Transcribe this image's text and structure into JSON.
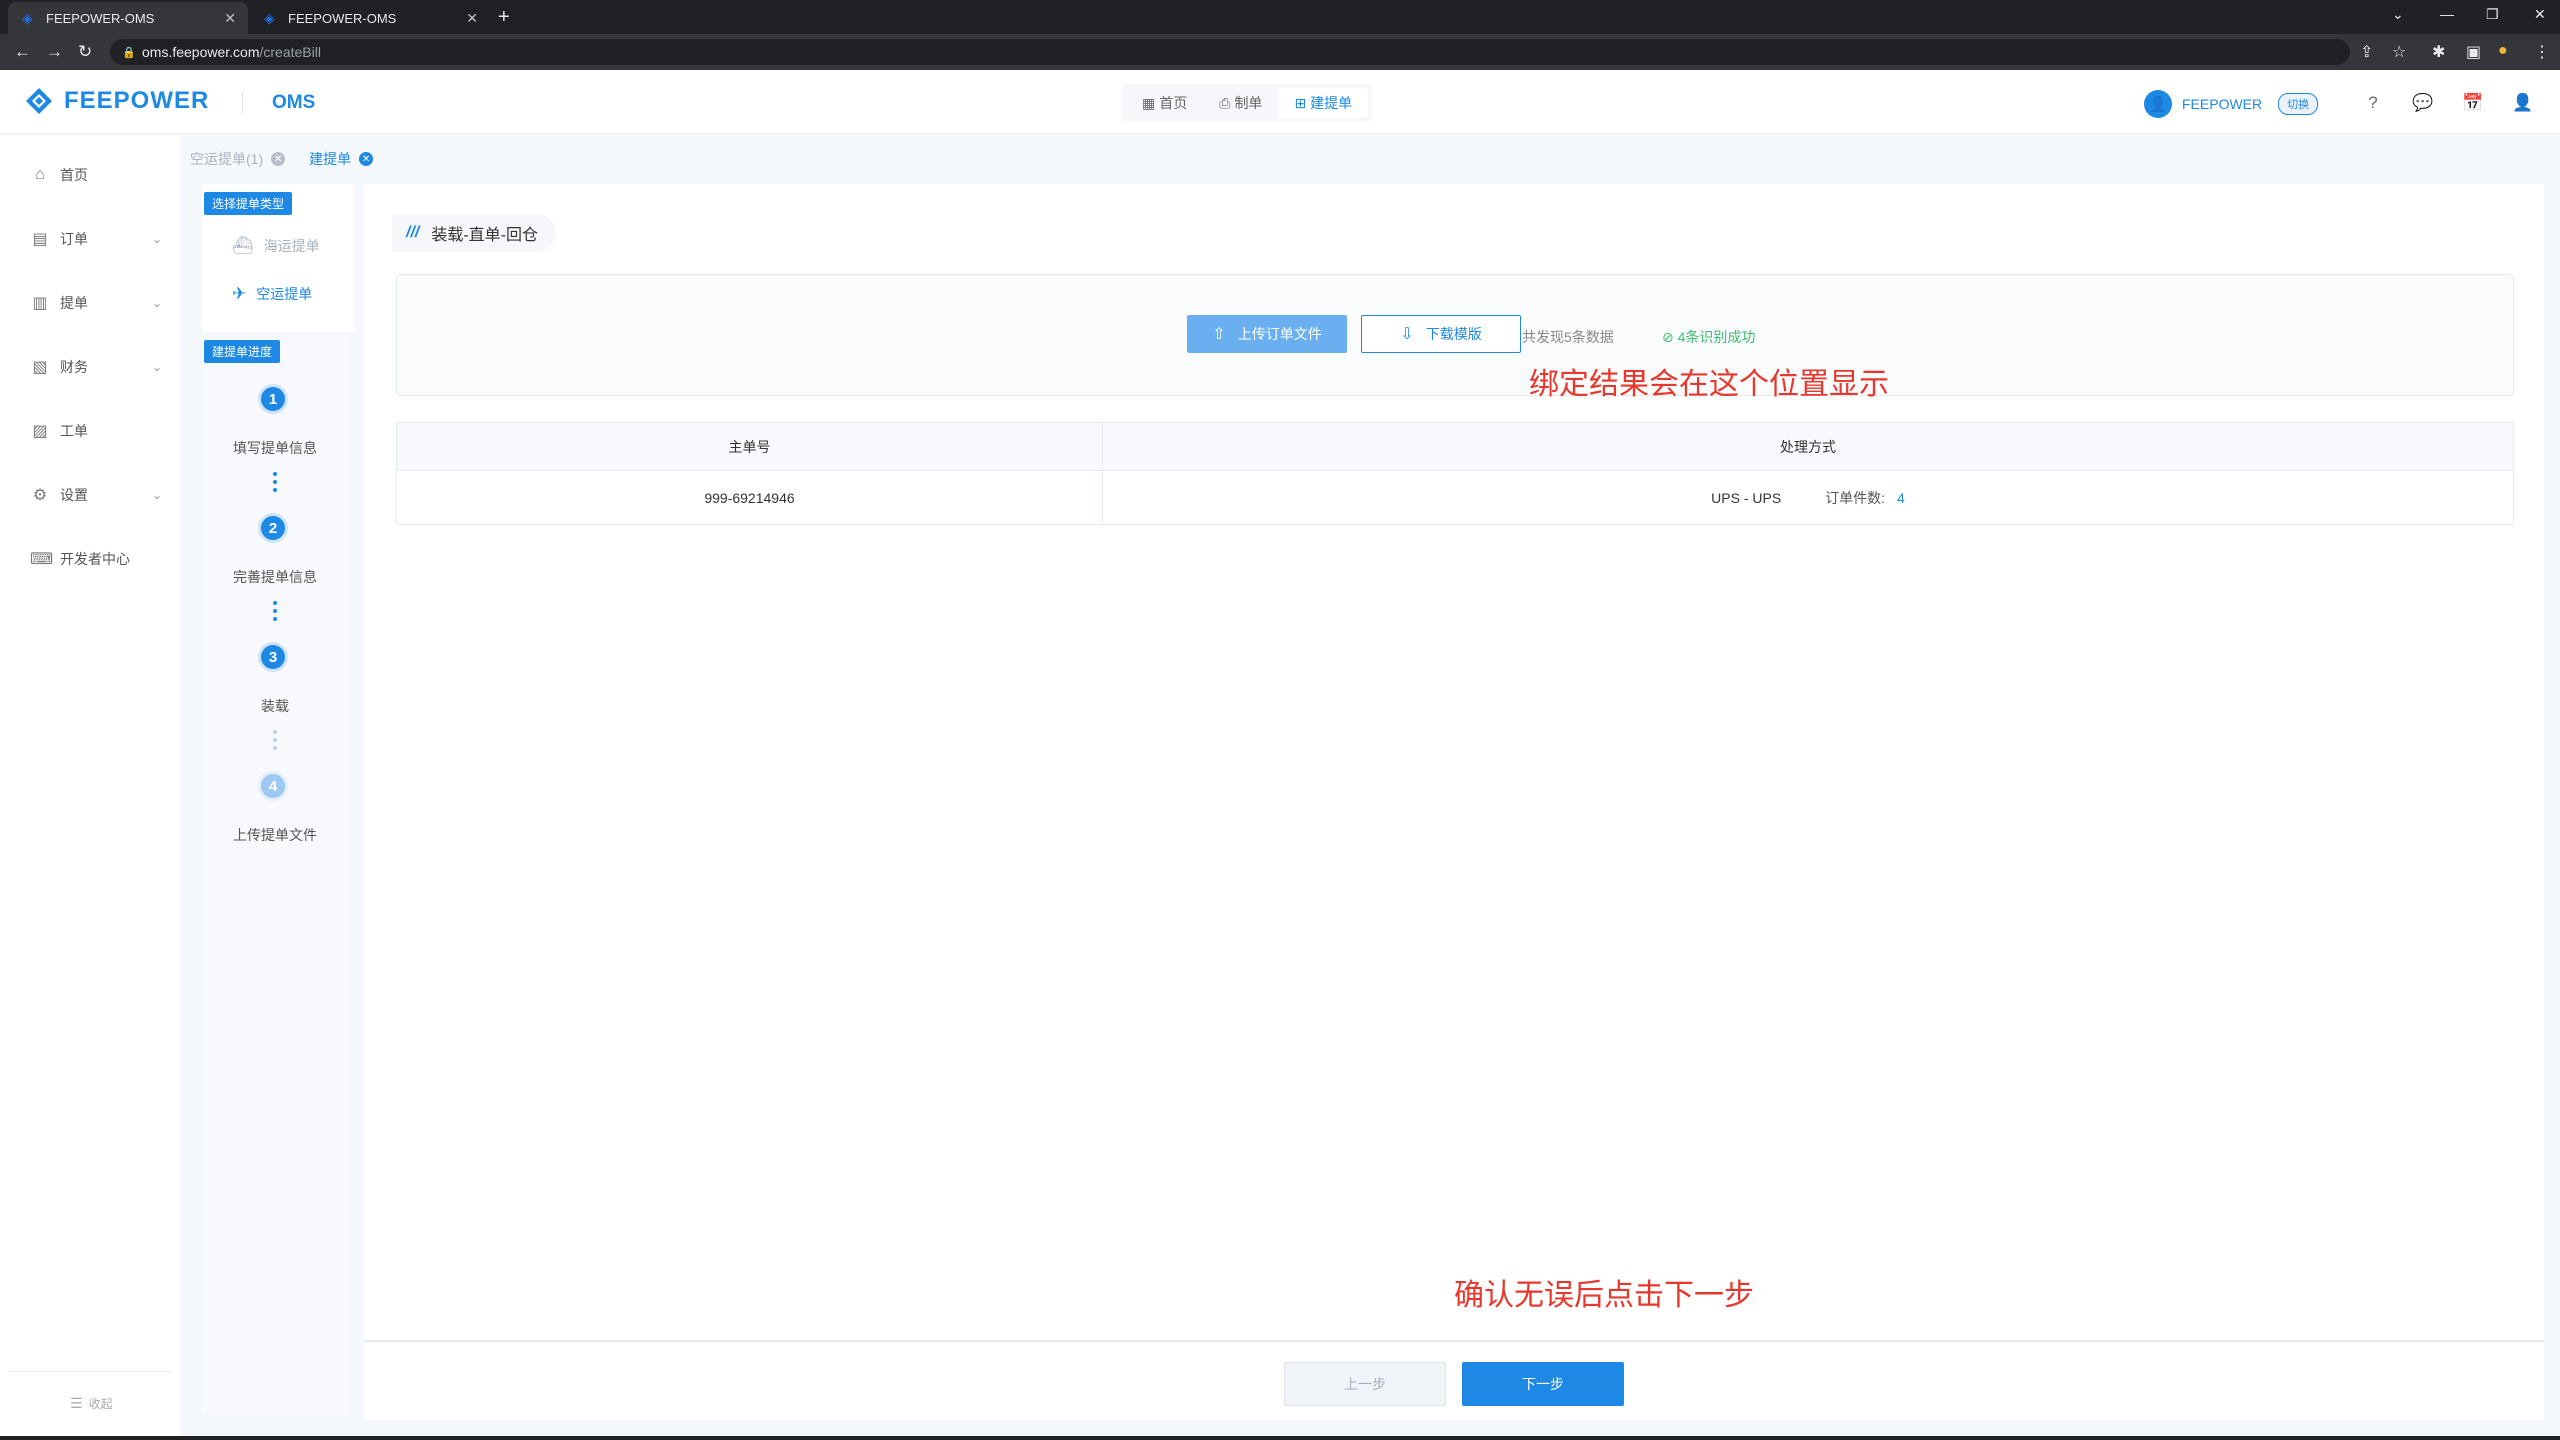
{
  "browser": {
    "tabs": [
      {
        "title": "FEEPOWER-OMS",
        "active": true
      },
      {
        "title": "FEEPOWER-OMS",
        "active": false
      }
    ],
    "url_host": "oms.feepower.com",
    "url_path": "/createBill"
  },
  "header": {
    "logo_text": "FEEPOWER",
    "product": "OMS",
    "nav": [
      {
        "label": "首页",
        "icon": "grid-icon",
        "active": false
      },
      {
        "label": "制单",
        "icon": "user-doc-icon",
        "active": false
      },
      {
        "label": "建提单",
        "icon": "doc-add-icon",
        "active": true
      }
    ],
    "username": "FEEPOWER",
    "switch_label": "切换"
  },
  "sidebar": {
    "items": [
      {
        "label": "首页",
        "icon": "home-icon",
        "expandable": false
      },
      {
        "label": "订单",
        "icon": "order-icon",
        "expandable": true
      },
      {
        "label": "提单",
        "icon": "bill-icon",
        "expandable": true
      },
      {
        "label": "财务",
        "icon": "finance-icon",
        "expandable": true
      },
      {
        "label": "工单",
        "icon": "ticket-icon",
        "expandable": false
      },
      {
        "label": "设置",
        "icon": "settings-icon",
        "expandable": true
      },
      {
        "label": "开发者中心",
        "icon": "developer-icon",
        "expandable": false
      }
    ],
    "collapse_label": "收起"
  },
  "page_tabs": [
    {
      "label": "空运提单(1)",
      "active": false
    },
    {
      "label": "建提单",
      "active": true
    }
  ],
  "steps_panel": {
    "type_tag": "选择提单类型",
    "types": [
      {
        "label": "海运提单",
        "active": false
      },
      {
        "label": "空运提单",
        "active": true
      }
    ],
    "progress_tag": "建提单进度",
    "steps": [
      {
        "number": "1",
        "label": "填写提单信息",
        "done": true
      },
      {
        "number": "2",
        "label": "完善提单信息",
        "done": true
      },
      {
        "number": "3",
        "label": "装载",
        "done": true
      },
      {
        "number": "4",
        "label": "上传提单文件",
        "done": false
      }
    ]
  },
  "main": {
    "section_title": "装载-直单-回仓",
    "upload_button": "上传订单文件",
    "download_button": "下载模版",
    "found_text": "共发现5条数据",
    "success_text": "4条识别成功",
    "annotation_result": "绑定结果会在这个位置显示",
    "table": {
      "headers": [
        "主单号",
        "处理方式"
      ],
      "rows": [
        {
          "master_no": "999-69214946",
          "method": "UPS - UPS",
          "count_label": "订单件数:",
          "count": "4"
        }
      ]
    },
    "annotation_next": "确认无误后点击下一步",
    "prev_button": "上一步",
    "next_button": "下一步"
  },
  "colors": {
    "accent": "#1e88e5",
    "success": "#3dbd6e",
    "annotation": "#e8372c"
  }
}
